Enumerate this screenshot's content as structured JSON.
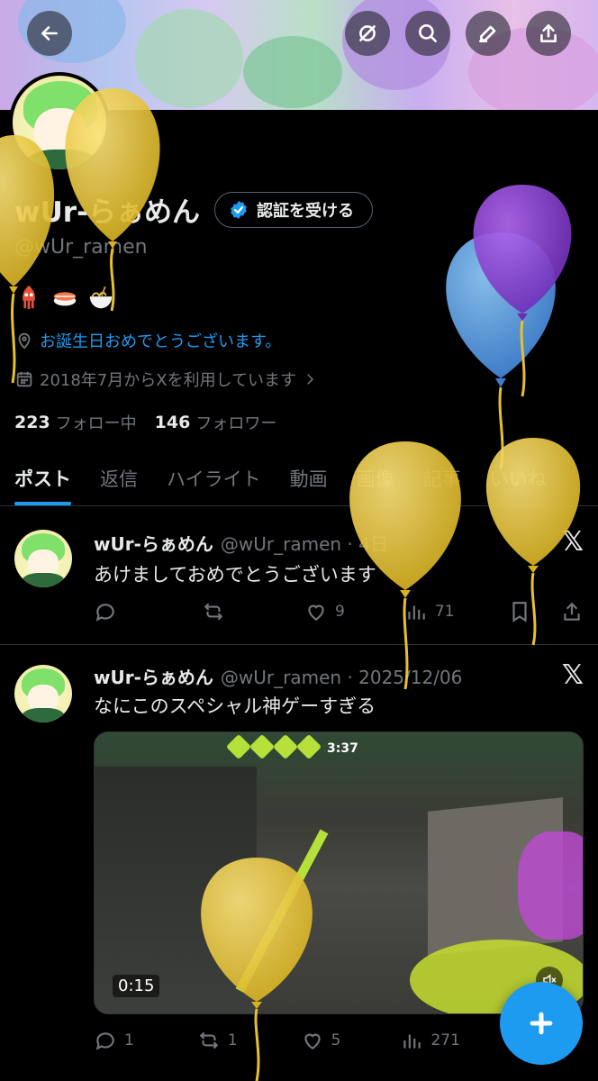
{
  "colors": {
    "background": "#000000",
    "accent": "#1d9bf0",
    "text": "#e7e9ea",
    "muted": "#71767b",
    "balloon_yellow": "#e6c02e",
    "balloon_blue": "#4a90d9",
    "balloon_purple": "#8a3fd1"
  },
  "topbar": {
    "back_icon": "arrow-left-icon",
    "actions": [
      "grok-icon",
      "search-icon",
      "edit-icon",
      "share-icon"
    ]
  },
  "profile": {
    "display_name": "wUr-らぁめん",
    "verify_label": "認証を受ける",
    "handle": "@wUr_ramen",
    "emojis": [
      "🦑",
      "🍣",
      "🍜"
    ],
    "location": "お誕生日おめでとうございます。",
    "joined": "2018年7月からXを利用しています",
    "following_count": "223",
    "following_label": "フォロー中",
    "followers_count": "146",
    "followers_label": "フォロワー"
  },
  "tabs": [
    {
      "label": "ポスト",
      "active": true
    },
    {
      "label": "返信",
      "active": false
    },
    {
      "label": "ハイライト",
      "active": false
    },
    {
      "label": "動画",
      "active": false
    },
    {
      "label": "画像",
      "active": false
    },
    {
      "label": "記事",
      "active": false
    },
    {
      "label": "いいね",
      "active": false
    }
  ],
  "posts": [
    {
      "name": "wUr-らぁめん",
      "meta": "@wUr_ramen · 4日",
      "text": "あけましておめでとうございます",
      "replies": "",
      "reposts": "",
      "likes": "9",
      "views": "71"
    },
    {
      "name": "wUr-らぁめん",
      "meta": "@wUr_ramen · 2025/12/06",
      "text": "なにこのスペシャル神ゲーすぎる",
      "media_time": "0:15",
      "media_clock": "3:37",
      "replies": "1",
      "reposts": "1",
      "likes": "5",
      "views": "271"
    }
  ],
  "x_logo": "𝕏",
  "balloon_count": 7
}
